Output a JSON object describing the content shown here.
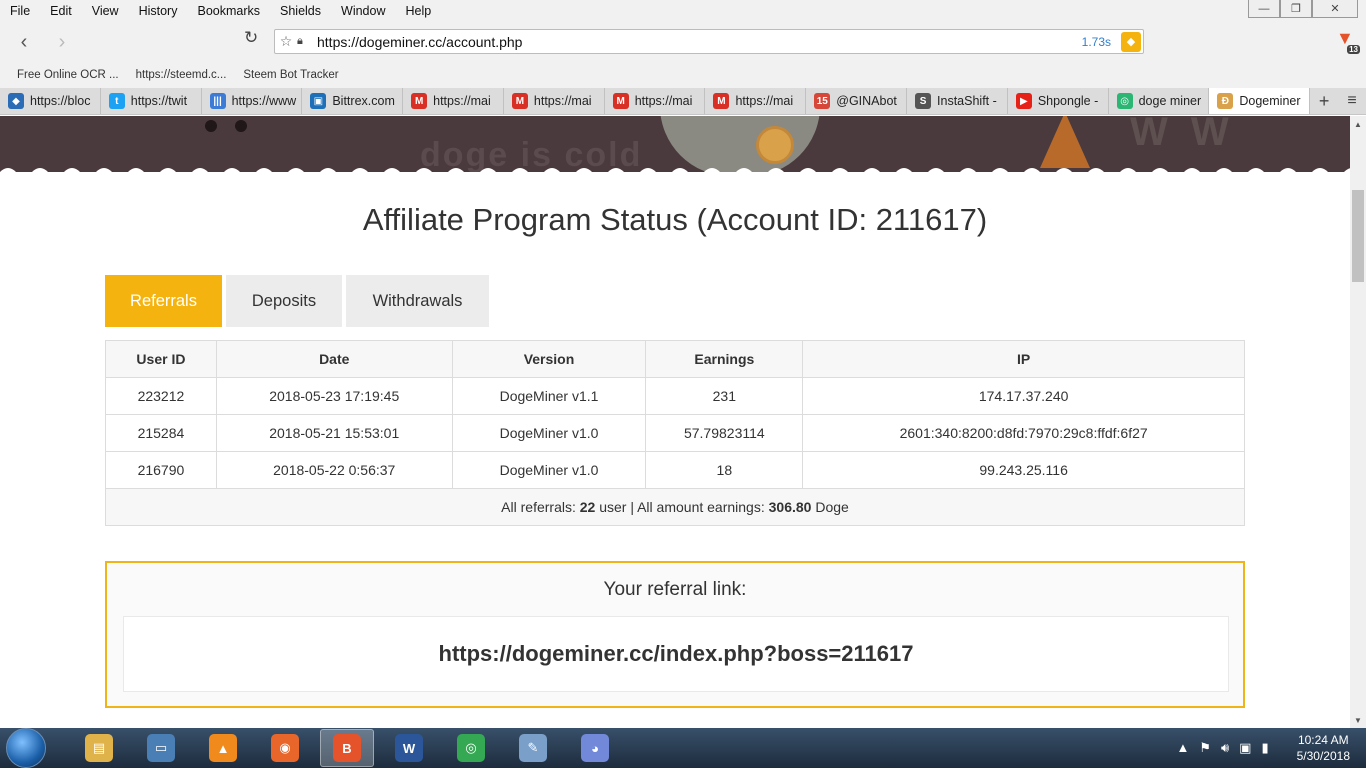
{
  "menu": [
    "File",
    "Edit",
    "View",
    "History",
    "Bookmarks",
    "Shields",
    "Window",
    "Help"
  ],
  "window_controls": {
    "minimize": "—",
    "restore": "❐",
    "close": "✕"
  },
  "browser": {
    "url": "https://dogeminer.cc/account.php",
    "timing": "1.73s",
    "brave_badge": "13"
  },
  "bookmarks": [
    "Free Online OCR ...",
    "https://steemd.c...",
    "Steem Bot Tracker"
  ],
  "tabs": [
    {
      "label": "https://bloc",
      "color": "#2a6db6",
      "glyph": "◆"
    },
    {
      "label": "https://twit",
      "color": "#1da1f2",
      "glyph": "t"
    },
    {
      "label": "https://www",
      "color": "#3c7bd6",
      "glyph": "|||"
    },
    {
      "label": "Bittrex.com",
      "color": "#1d6fb8",
      "glyph": "▣"
    },
    {
      "label": "https://mai",
      "color": "#d93025",
      "glyph": "M"
    },
    {
      "label": "https://mai",
      "color": "#d93025",
      "glyph": "M"
    },
    {
      "label": "https://mai",
      "color": "#d93025",
      "glyph": "M"
    },
    {
      "label": "https://mai",
      "color": "#d93025",
      "glyph": "M"
    },
    {
      "label": "@GINAbot",
      "color": "#d6473a",
      "glyph": "15"
    },
    {
      "label": "InstaShift -",
      "color": "#555",
      "glyph": "S"
    },
    {
      "label": "Shpongle -",
      "color": "#e62117",
      "glyph": "▶"
    },
    {
      "label": "doge miner",
      "color": "#2bb673",
      "glyph": "◎"
    },
    {
      "label": "Dogeminer",
      "color": "#d9a14a",
      "glyph": "Ð"
    }
  ],
  "banner_text": "doge is cold",
  "page": {
    "title": "Affiliate Program Status (Account ID: 211617)",
    "tabs": [
      "Referrals",
      "Deposits",
      "Withdrawals"
    ],
    "active_tab": "Referrals",
    "table": {
      "headers": [
        "User ID",
        "Date",
        "Version",
        "Earnings",
        "IP"
      ],
      "rows": [
        [
          "223212",
          "2018-05-23 17:19:45",
          "DogeMiner v1.1",
          "231",
          "174.17.37.240"
        ],
        [
          "215284",
          "2018-05-21 15:53:01",
          "DogeMiner v1.0",
          "57.79823114",
          "2601:340:8200:d8fd:7970:29c8:ffdf:6f27"
        ],
        [
          "216790",
          "2018-05-22 0:56:37",
          "DogeMiner v1.0",
          "18",
          "99.243.25.116"
        ]
      ],
      "footer": {
        "prefix": "All referrals: ",
        "count": "22",
        "mid": " user | All amount earnings: ",
        "amount": "306.80",
        "suffix": " Doge"
      }
    },
    "referral": {
      "label": "Your referral link:",
      "link": "https://dogeminer.cc/index.php?boss=211617"
    }
  },
  "accent_color": "#f5b30f",
  "taskbar": {
    "apps": [
      {
        "name": "file-explorer",
        "glyph": "▤",
        "color": "#e0b24a"
      },
      {
        "name": "computer",
        "glyph": "▭",
        "color": "#4a7fb5"
      },
      {
        "name": "vlc",
        "glyph": "▲",
        "color": "#f08a1c"
      },
      {
        "name": "firefox",
        "glyph": "◉",
        "color": "#e8662a"
      },
      {
        "name": "brave",
        "glyph": "B",
        "color": "#e4532a"
      },
      {
        "name": "word",
        "glyph": "W",
        "color": "#2b579a"
      },
      {
        "name": "chrome",
        "glyph": "◎",
        "color": "#34a853"
      },
      {
        "name": "paint",
        "glyph": "✎",
        "color": "#7a9fc9"
      },
      {
        "name": "discord",
        "glyph": "◕",
        "color": "#7289da"
      }
    ],
    "time": "10:24 AM",
    "date": "5/30/2018"
  }
}
